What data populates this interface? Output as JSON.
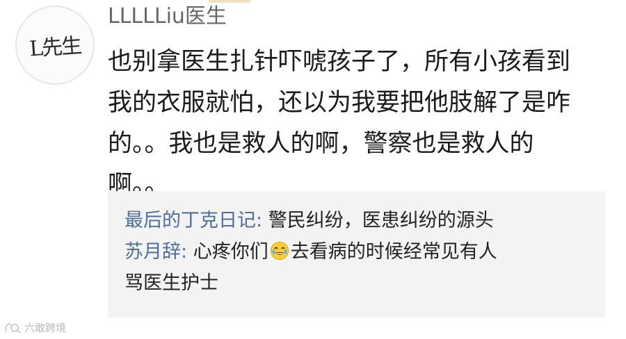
{
  "avatar": {
    "text": "L先生"
  },
  "comment": {
    "username": "LLLLLiu医生",
    "body_lines": [
      "也别拿医生扎针吓唬孩子了，所有小孩看到",
      "我的衣服就怕，还以为我要把他肢解了是咋",
      "的。。我也是救人的啊，警察也是救人的",
      "啊。。"
    ]
  },
  "replies": [
    {
      "author": "最后的丁克日记:",
      "text": " 警民纠纷，医患纠纷的源头"
    },
    {
      "author": "苏月辞:",
      "text_before_icon": " 心疼你们",
      "icon": "crying-laughing-emoji-icon",
      "text_after_icon": "去看病的时候经常见有人",
      "continuation": "骂医生护士"
    }
  ],
  "watermark": {
    "text": "六敢跨境"
  },
  "colors": {
    "reply_author": "#4e6e9e",
    "reply_background": "#f3f3f3",
    "username": "#666666"
  }
}
